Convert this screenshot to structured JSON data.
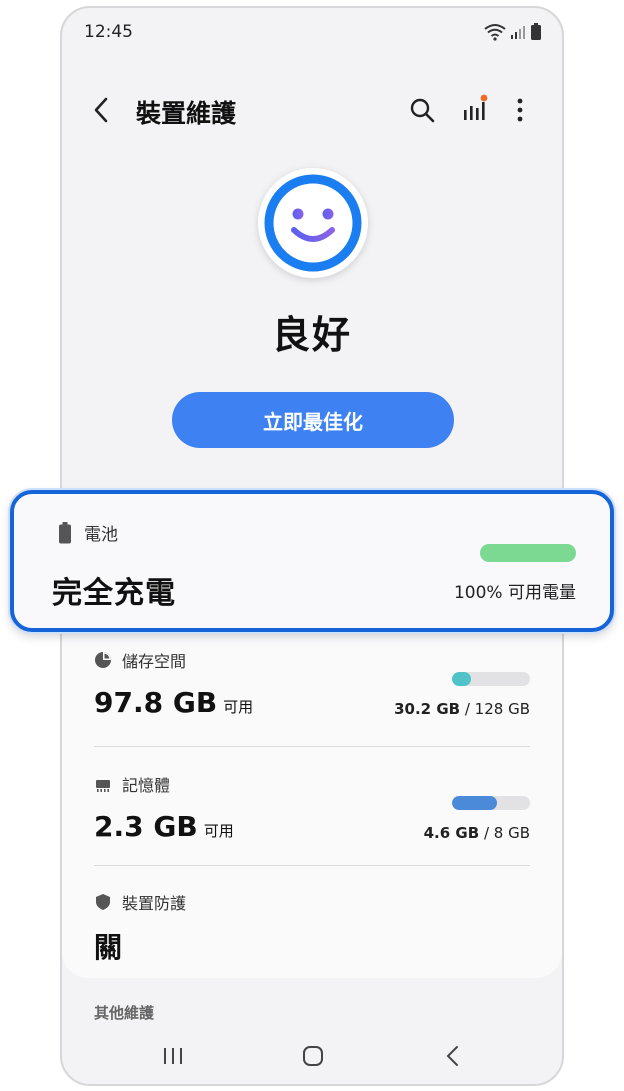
{
  "status_bar": {
    "time": "12:45"
  },
  "app_bar": {
    "title": "裝置維護"
  },
  "device_status": {
    "label": "良好"
  },
  "optimize_button": {
    "label": "立即最佳化"
  },
  "battery": {
    "title": "電池",
    "value": "完全充電",
    "usage_text": "100% 可用電量",
    "level_fraction": 1.0,
    "bar_color": "#7cd992"
  },
  "storage": {
    "title": "儲存空間",
    "value": "97.8 GB",
    "unit": "可用",
    "used": "30.2 GB",
    "total": "/ 128 GB",
    "used_fraction": 0.24,
    "bar_color": "#4fc3c7"
  },
  "memory": {
    "title": "記憶體",
    "value": "2.3 GB",
    "unit": "可用",
    "used": "4.6 GB",
    "total": "/ 8 GB",
    "used_fraction": 0.575,
    "bar_color": "#4a8ad8"
  },
  "device_protection": {
    "title": "裝置防護",
    "value": "關"
  },
  "other_section": {
    "label": "其他維護"
  },
  "colors": {
    "accent": "#3d81f2",
    "callout_border": "#1565d8",
    "notification_dot": "#f06a2a"
  }
}
